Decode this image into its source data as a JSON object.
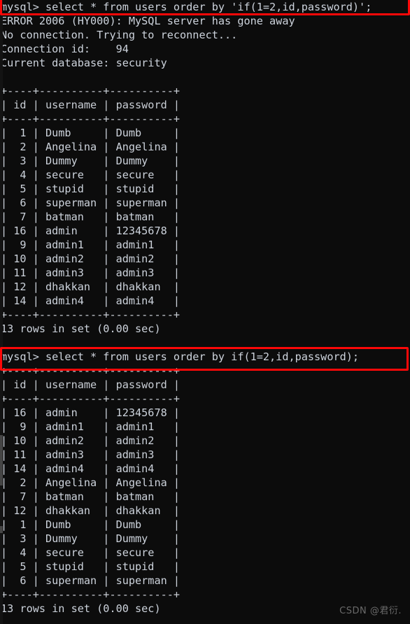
{
  "terminal": {
    "title": "mysql-client-terminal",
    "background_color": "#0c0c0c",
    "text_color": "#cdd3dc",
    "highlight_color": "#fb0808"
  },
  "session": {
    "prompt": "mysql>",
    "query_1": "mysql> select * from users order by 'if(1=2,id,password)';",
    "error_line": "ERROR 2006 (HY000): MySQL server has gone away",
    "reconnect_line": "No connection. Trying to reconnect...",
    "connection_id_line": "Connection id:    94",
    "current_database_line": "Current database: security",
    "query_2": "mysql> select * from users order by if(1=2,id,password);",
    "result_1_footer": "13 rows in set (0.00 sec)",
    "result_2_footer": "13 rows in set (0.00 sec)"
  },
  "table_format": {
    "separator": "+----+----------+----------+",
    "header_row": "| id | username | password |"
  },
  "result_1": {
    "columns": [
      "id",
      "username",
      "password"
    ],
    "rows": [
      [
        "1",
        "Dumb",
        "Dumb"
      ],
      [
        "2",
        "Angelina",
        "Angelina"
      ],
      [
        "3",
        "Dummy",
        "Dummy"
      ],
      [
        "4",
        "secure",
        "secure"
      ],
      [
        "5",
        "stupid",
        "stupid"
      ],
      [
        "6",
        "superman",
        "superman"
      ],
      [
        "7",
        "batman",
        "batman"
      ],
      [
        "16",
        "admin",
        "12345678"
      ],
      [
        "9",
        "admin1",
        "admin1"
      ],
      [
        "10",
        "admin2",
        "admin2"
      ],
      [
        "11",
        "admin3",
        "admin3"
      ],
      [
        "12",
        "dhakkan",
        "dhakkan"
      ],
      [
        "14",
        "admin4",
        "admin4"
      ]
    ]
  },
  "result_2": {
    "columns": [
      "id",
      "username",
      "password"
    ],
    "rows": [
      [
        "16",
        "admin",
        "12345678"
      ],
      [
        "9",
        "admin1",
        "admin1"
      ],
      [
        "10",
        "admin2",
        "admin2"
      ],
      [
        "11",
        "admin3",
        "admin3"
      ],
      [
        "14",
        "admin4",
        "admin4"
      ],
      [
        "2",
        "Angelina",
        "Angelina"
      ],
      [
        "7",
        "batman",
        "batman"
      ],
      [
        "12",
        "dhakkan",
        "dhakkan"
      ],
      [
        "1",
        "Dumb",
        "Dumb"
      ],
      [
        "3",
        "Dummy",
        "Dummy"
      ],
      [
        "4",
        "secure",
        "secure"
      ],
      [
        "5",
        "stupid",
        "stupid"
      ],
      [
        "6",
        "superman",
        "superman"
      ]
    ]
  },
  "watermark": {
    "text": "CSDN @君衍."
  }
}
